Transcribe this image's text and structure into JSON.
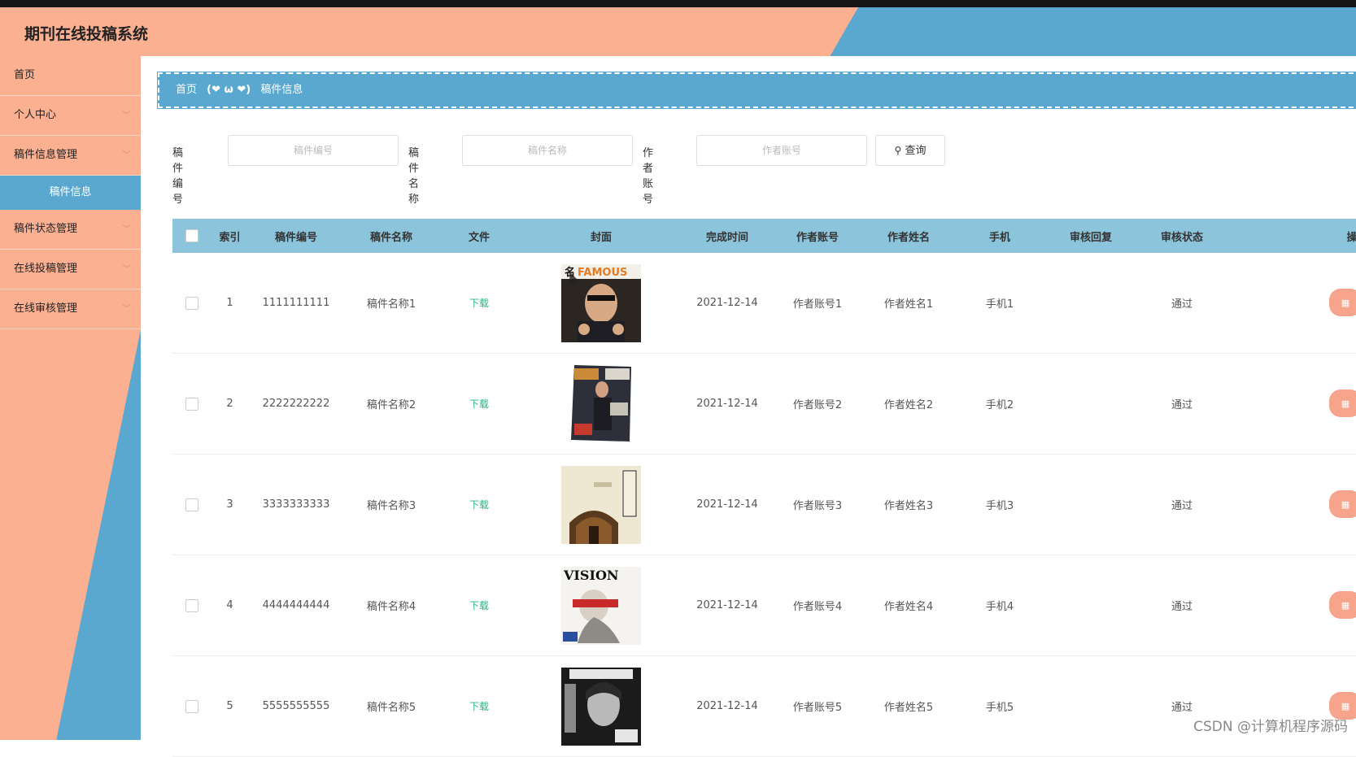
{
  "app": {
    "title": "期刊在线投稿系统"
  },
  "sidebar": {
    "items": [
      {
        "label": "首页",
        "has_children": false
      },
      {
        "label": "个人中心",
        "has_children": true
      },
      {
        "label": "稿件信息管理",
        "has_children": true
      },
      {
        "label": "稿件状态管理",
        "has_children": true
      },
      {
        "label": "在线投稿管理",
        "has_children": true
      },
      {
        "label": "在线审核管理",
        "has_children": true
      }
    ],
    "active_sub": "稿件信息"
  },
  "breadcrumb": {
    "home": "首页",
    "separator": "(❤ ω ❤)",
    "current": "稿件信息"
  },
  "search": {
    "fields": [
      {
        "label": "稿件编号",
        "placeholder": "稿件编号"
      },
      {
        "label": "稿件名称",
        "placeholder": "稿件名称"
      },
      {
        "label": "作者账号",
        "placeholder": "作者账号"
      }
    ],
    "button_label": "查询"
  },
  "table": {
    "headers": [
      "索引",
      "稿件编号",
      "稿件名称",
      "文件",
      "封面",
      "完成时间",
      "作者账号",
      "作者姓名",
      "手机",
      "审核回复",
      "审核状态",
      "操"
    ],
    "rows": [
      {
        "index": "1",
        "code": "1111111111",
        "name": "稿件名称1",
        "file": "下载",
        "cover": "magazine-cover-famous",
        "date": "2021-12-14",
        "account": "作者账号1",
        "author": "作者姓名1",
        "phone": "手机1",
        "reply": "",
        "status": "通过"
      },
      {
        "index": "2",
        "code": "2222222222",
        "name": "稿件名称2",
        "file": "下载",
        "cover": "magazine-cover-fitness",
        "date": "2021-12-14",
        "account": "作者账号2",
        "author": "作者姓名2",
        "phone": "手机2",
        "reply": "",
        "status": "通过"
      },
      {
        "index": "3",
        "code": "3333333333",
        "name": "稿件名称3",
        "file": "下载",
        "cover": "magazine-cover-religion",
        "date": "2021-12-14",
        "account": "作者账号3",
        "author": "作者姓名3",
        "phone": "手机3",
        "reply": "",
        "status": "通过"
      },
      {
        "index": "4",
        "code": "4444444444",
        "name": "稿件名称4",
        "file": "下载",
        "cover": "magazine-cover-vision",
        "date": "2021-12-14",
        "account": "作者账号4",
        "author": "作者姓名4",
        "phone": "手机4",
        "reply": "",
        "status": "通过"
      },
      {
        "index": "5",
        "code": "5555555555",
        "name": "稿件名称5",
        "file": "下载",
        "cover": "magazine-cover-rolling-stone",
        "date": "2021-12-14",
        "account": "作者账号5",
        "author": "作者姓名5",
        "phone": "手机5",
        "reply": "",
        "status": "通过"
      }
    ],
    "op_icon": "detail-icon"
  },
  "colors": {
    "accent_salmon": "#fbb092",
    "accent_blue": "#5aa8cf",
    "table_head": "#8cc4dc",
    "link_green": "#2bb089"
  },
  "watermark": "CSDN @计算机程序源码"
}
